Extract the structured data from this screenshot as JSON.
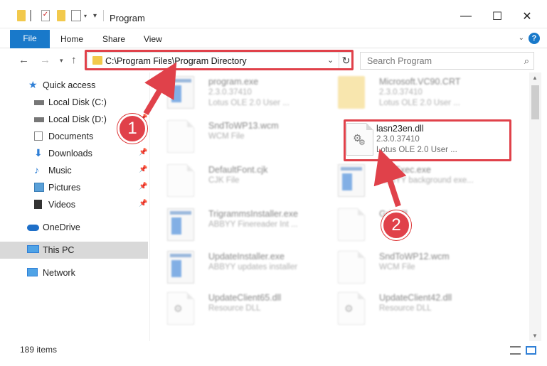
{
  "window": {
    "title": "Program",
    "minimize_glyph": "—",
    "maximize_glyph": "☐",
    "close_glyph": "✕"
  },
  "ribbon": {
    "tabs": [
      "File",
      "Home",
      "Share",
      "View"
    ],
    "help_glyph": "?"
  },
  "address": {
    "path": "C:\\Program Files\\Program Directory",
    "search_placeholder": "Search Program"
  },
  "sidebar": {
    "items": [
      {
        "label": "Quick access",
        "icon": "star-icon"
      },
      {
        "label": "Local Disk (C:)",
        "icon": "drive-icon"
      },
      {
        "label": "Local Disk (D:)",
        "icon": "drive-icon"
      },
      {
        "label": "Documents",
        "icon": "documents-icon"
      },
      {
        "label": "Downloads",
        "icon": "download-icon"
      },
      {
        "label": "Music",
        "icon": "music-icon"
      },
      {
        "label": "Pictures",
        "icon": "pictures-icon"
      },
      {
        "label": "Videos",
        "icon": "videos-icon"
      },
      {
        "label": "OneDrive",
        "icon": "cloud-icon"
      },
      {
        "label": "This PC",
        "icon": "computer-icon"
      },
      {
        "label": "Network",
        "icon": "network-icon"
      }
    ]
  },
  "files": [
    {
      "name": "program.exe",
      "type": "2.3.0.37410",
      "desc": "Lotus OLE 2.0 User ...",
      "icon": "app"
    },
    {
      "name": "Microsoft.VC90.CRT",
      "type": "2.3.0.37410",
      "desc": "Lotus OLE 2.0 User ...",
      "icon": "folder"
    },
    {
      "name": "SndToWP13.wcm",
      "type": "WCM File",
      "desc": "",
      "icon": "doc"
    },
    {
      "name": "lasn23en.dll",
      "type": "2.3.0.37410",
      "desc": "Lotus OLE 2.0 User ...",
      "icon": "dll"
    },
    {
      "name": "DefaultFont.cjk",
      "type": "CJK File",
      "desc": "",
      "icon": "doc"
    },
    {
      "name": "BkgExec.exe",
      "type": "ABBYY background exe...",
      "desc": "",
      "icon": "app"
    },
    {
      "name": "TrigrammsInstaller.exe",
      "type": "ABBYY Finereader Int ...",
      "desc": "",
      "icon": "app"
    },
    {
      "name": "Grid.dll",
      "type": "",
      "desc": "",
      "icon": "doc"
    },
    {
      "name": "UpdateInstaller.exe",
      "type": "ABBYY updates installer",
      "desc": "",
      "icon": "app"
    },
    {
      "name": "SndToWP12.wcm",
      "type": "WCM File",
      "desc": "",
      "icon": "doc"
    },
    {
      "name": "UpdateClient65.dll",
      "type": "Resource DLL",
      "desc": "",
      "icon": "dll"
    },
    {
      "name": "UpdateClient42.dll",
      "type": "Resource DLL",
      "desc": "",
      "icon": "dll"
    }
  ],
  "status": {
    "item_count": "189 items"
  },
  "annotations": {
    "badge1": "1",
    "badge2": "2"
  },
  "colors": {
    "accent": "#1979ca",
    "highlight_red": "#e0414a",
    "selected_bg": "#d9d9d9"
  }
}
